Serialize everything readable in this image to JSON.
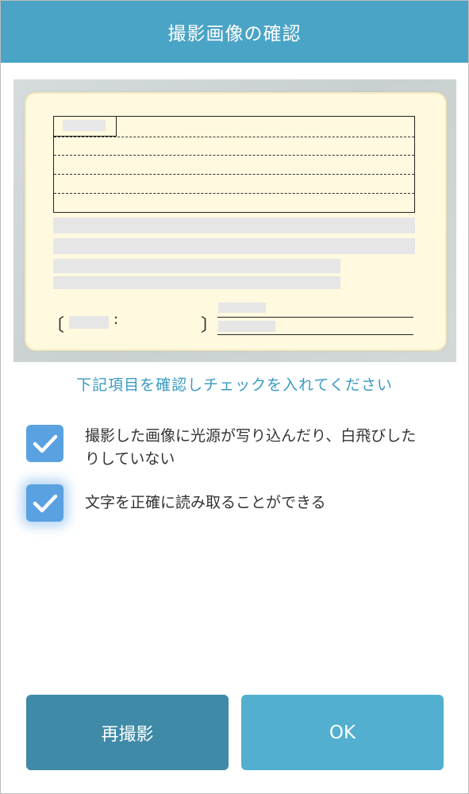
{
  "header": {
    "title": "撮影画像の確認"
  },
  "instruction": "下記項目を確認しチェックを入れてください",
  "card": {
    "colon": ":"
  },
  "checklist": [
    {
      "label": "撮影した画像に光源が写り込んだり、白飛びしたりしていない",
      "checked": true
    },
    {
      "label": "文字を正確に読み取ることができる",
      "checked": true
    }
  ],
  "buttons": {
    "retake": "再撮影",
    "ok": "OK"
  },
  "colors": {
    "header": "#4aa4c6",
    "checkbox": "#5aa1e2",
    "retake": "#3f8aa6",
    "ok": "#52afcf",
    "instruction": "#3a9ac3"
  }
}
